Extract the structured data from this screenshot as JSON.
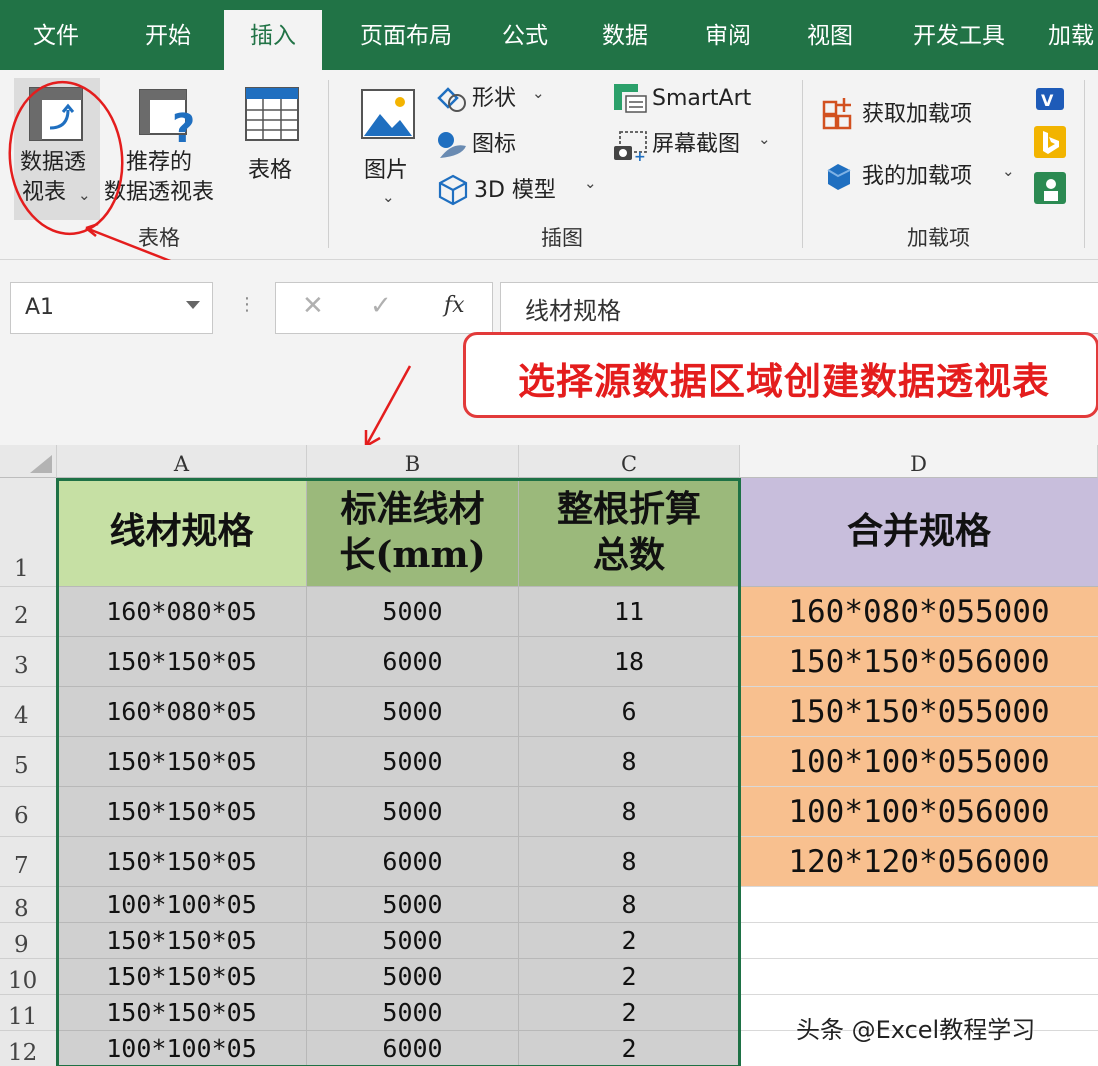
{
  "tabs": [
    "文件",
    "开始",
    "插入",
    "页面布局",
    "公式",
    "数据",
    "审阅",
    "视图",
    "开发工具",
    "加载"
  ],
  "active_tab": "插入",
  "ribbon": {
    "tables_group": {
      "pivot_table": [
        "数据透",
        "视表"
      ],
      "recommended_pivot": [
        "推荐的",
        "数据透视表"
      ],
      "table": "表格",
      "label": "表格"
    },
    "illustrations_group": {
      "pictures": "图片",
      "shapes": "形状",
      "icons": "图标",
      "model_3d": "3D 模型",
      "smartart": "SmartArt",
      "screenshot": "屏幕截图",
      "label": "插图"
    },
    "addins_group": {
      "get_addins": "获取加载项",
      "my_addins": "我的加载项",
      "label": "加载项"
    }
  },
  "formula_bar": {
    "name_box": "A1",
    "cancel": "✕",
    "enter": "✓",
    "fx": "fx",
    "value": "线材规格"
  },
  "callout": "选择源数据区域创建数据透视表",
  "columns": [
    "A",
    "B",
    "C",
    "D"
  ],
  "header_row": {
    "row_num": "1",
    "a": "线材规格",
    "b": [
      "标准线材",
      "长(mm)"
    ],
    "c": [
      "整根折算",
      "总数"
    ],
    "d": "合并规格"
  },
  "rows": [
    {
      "n": "2",
      "a": "160*080*05",
      "b": "5000",
      "c": "11",
      "d": "160*080*055000"
    },
    {
      "n": "3",
      "a": "150*150*05",
      "b": "6000",
      "c": "18",
      "d": "150*150*056000"
    },
    {
      "n": "4",
      "a": "160*080*05",
      "b": "5000",
      "c": "6",
      "d": "150*150*055000"
    },
    {
      "n": "5",
      "a": "150*150*05",
      "b": "5000",
      "c": "8",
      "d": "100*100*055000"
    },
    {
      "n": "6",
      "a": "150*150*05",
      "b": "5000",
      "c": "8",
      "d": "100*100*056000"
    },
    {
      "n": "7",
      "a": "150*150*05",
      "b": "6000",
      "c": "8",
      "d": "120*120*056000"
    },
    {
      "n": "8",
      "a": "100*100*05",
      "b": "5000",
      "c": "8",
      "d": ""
    },
    {
      "n": "9",
      "a": "150*150*05",
      "b": "5000",
      "c": "2",
      "d": ""
    },
    {
      "n": "10",
      "a": "150*150*05",
      "b": "5000",
      "c": "2",
      "d": ""
    },
    {
      "n": "11",
      "a": "150*150*05",
      "b": "5000",
      "c": "2",
      "d": ""
    },
    {
      "n": "12",
      "a": "100*100*05",
      "b": "6000",
      "c": "2",
      "d": ""
    }
  ],
  "colors": {
    "excel_green": "#217346",
    "header_a": "#c6e0a4",
    "header_bc": "#9bb97b",
    "header_d": "#c8bedc",
    "data_gray": "#d0d0d0",
    "merged_orange": "#f8c08f",
    "annotation_red": "#e41d1d"
  },
  "watermark": "头条 @Excel教程学习"
}
